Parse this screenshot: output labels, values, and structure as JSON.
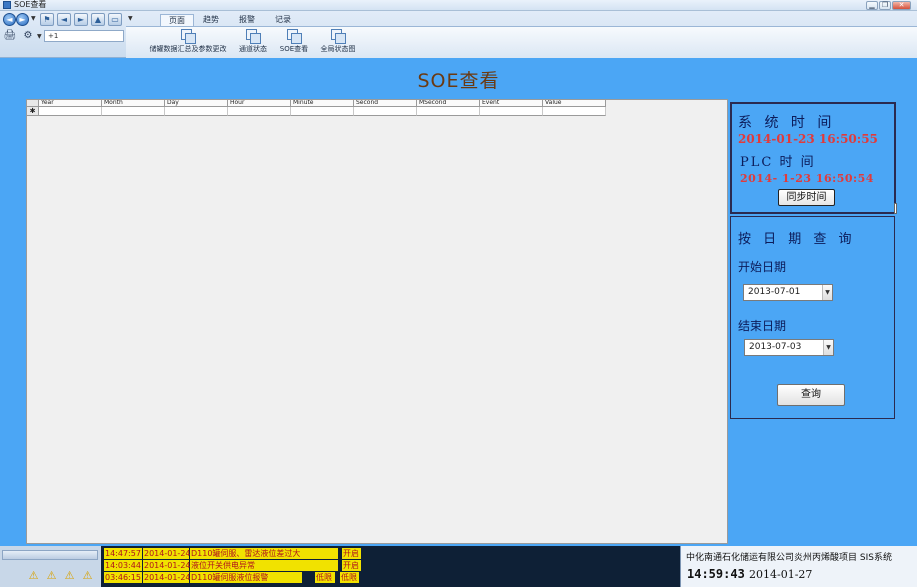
{
  "window": {
    "title": "SOE查看",
    "minimize": "▁",
    "restore": "❐",
    "close": "✕"
  },
  "quick_access": {
    "back_icon": "◄",
    "forward_icon": "►",
    "home_icon": "⌂",
    "up_icon": "▲",
    "zoom_value": "+1",
    "print_icon": "🖨",
    "tool_icon": "⚙"
  },
  "ribbon": {
    "tabs": [
      {
        "label": "页面",
        "active": true
      },
      {
        "label": "趋势",
        "active": false
      },
      {
        "label": "报警",
        "active": false
      },
      {
        "label": "记录",
        "active": false
      }
    ],
    "buttons": [
      {
        "label": "储罐数据汇总及参数更改"
      },
      {
        "label": "通道状态"
      },
      {
        "label": "SOE查看"
      },
      {
        "label": "全局状态图"
      }
    ]
  },
  "page": {
    "title": "SOE查看"
  },
  "grid": {
    "columns": [
      "Year",
      "Month",
      "Day",
      "Hour",
      "Minute",
      "Second",
      "MSecond",
      "Event",
      "Value"
    ],
    "new_row_marker": "✱"
  },
  "time_panel": {
    "system_label": "系 统 时 间",
    "system_time": "2014-01-23   16:50:55",
    "plc_label": "PLC 时 间",
    "plc_time": "2014- 1-23  16:50:54",
    "sync_button": "同步时间"
  },
  "query_panel": {
    "title": "按 日 期 查 询",
    "start_label": "开始日期",
    "start_value": "2013-07-01",
    "end_label": "结束日期",
    "end_value": "2013-07-03",
    "query_button": "查询"
  },
  "alarms": [
    {
      "time": "14:47:57",
      "date": "2014-01-24",
      "desc": "D110罐伺服、雷达液位差过大",
      "state": "",
      "action": "开启"
    },
    {
      "time": "14:03:44",
      "date": "2014-01-24",
      "desc": "液位开关供电异常",
      "state": "",
      "action": "开启"
    },
    {
      "time": "03:46:15",
      "date": "2014-01-24",
      "desc": "D110罐伺服液位报警",
      "state": "低限",
      "action": "低限"
    }
  ],
  "status": {
    "company": "中化南通石化储运有限公司炎州丙烯酸项目   SIS系统",
    "clock": "14:59:43",
    "date": "2014-01-27"
  }
}
